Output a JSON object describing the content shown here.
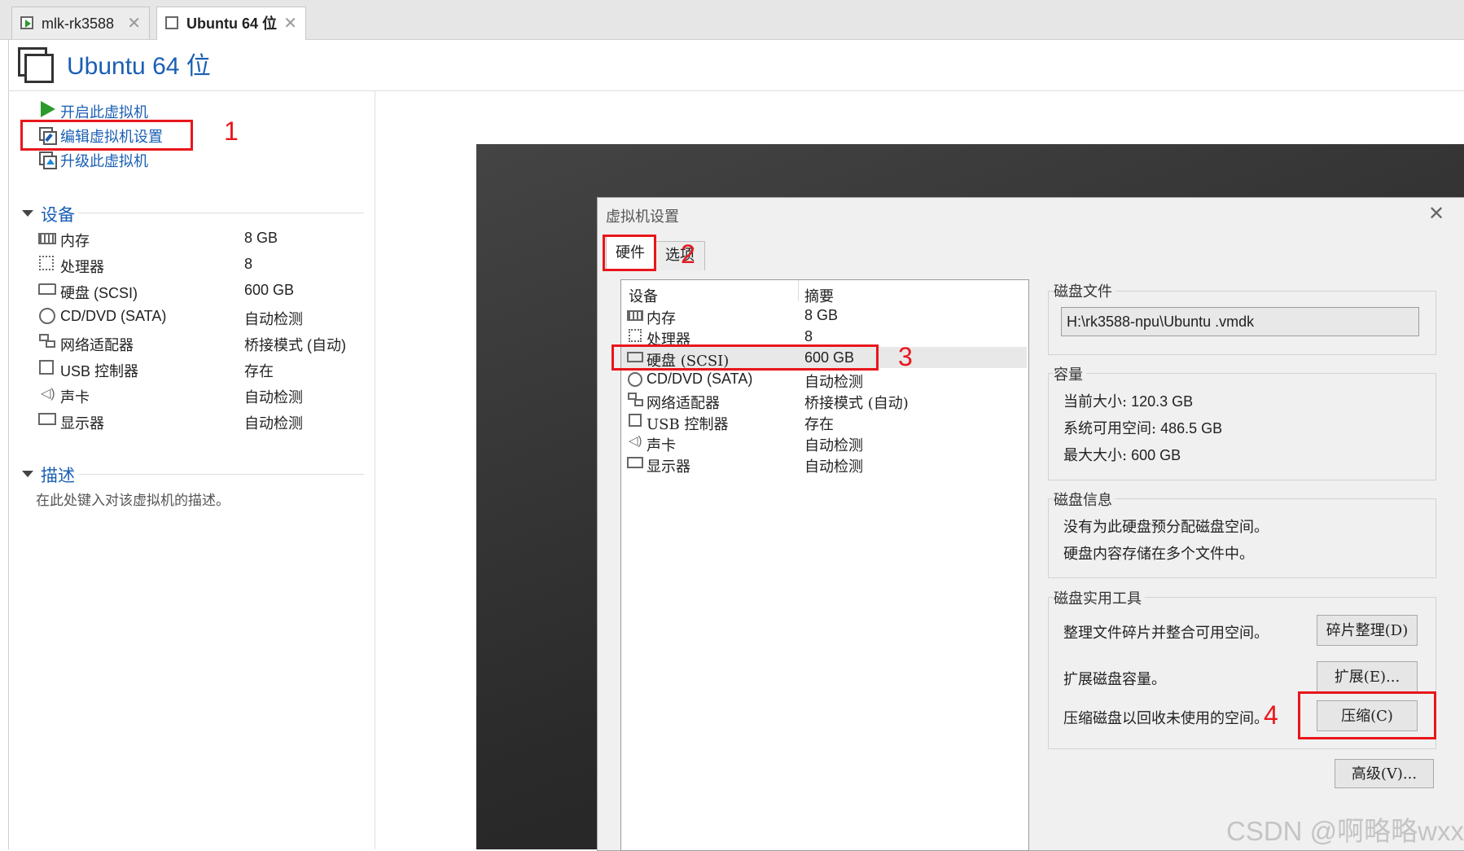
{
  "tabs": [
    {
      "label": "mlk-rk3588"
    },
    {
      "label": "Ubuntu 64 位"
    }
  ],
  "vm": {
    "title": "Ubuntu 64 位"
  },
  "actions": [
    {
      "label": "开启此虚拟机",
      "icon": "play-icon"
    },
    {
      "label": "编辑虚拟机设置",
      "icon": "edit-settings-icon"
    },
    {
      "label": "升级此虚拟机",
      "icon": "upgrade-icon"
    }
  ],
  "devices_section": {
    "title": "设备",
    "items": [
      {
        "name": "内存",
        "value": "8 GB",
        "icon": "memory-icon"
      },
      {
        "name": "处理器",
        "value": "8",
        "icon": "cpu-icon"
      },
      {
        "name": "硬盘 (SCSI)",
        "value": "600 GB",
        "icon": "hard-disk-icon"
      },
      {
        "name": "CD/DVD (SATA)",
        "value": "自动检测",
        "icon": "cd-dvd-icon"
      },
      {
        "name": "网络适配器",
        "value": "桥接模式 (自动)",
        "icon": "network-adapter-icon"
      },
      {
        "name": "USB 控制器",
        "value": "存在",
        "icon": "usb-controller-icon"
      },
      {
        "name": "声卡",
        "value": "自动检测",
        "icon": "sound-card-icon"
      },
      {
        "name": "显示器",
        "value": "自动检测",
        "icon": "display-icon"
      }
    ]
  },
  "description_section": {
    "title": "描述",
    "placeholder": "在此处键入对该虚拟机的描述。"
  },
  "annotations": [
    "1",
    "2",
    "3",
    "4"
  ],
  "dialog": {
    "title": "虚拟机设置",
    "tabs": [
      "硬件",
      "选项"
    ],
    "list_headers": {
      "device": "设备",
      "summary": "摘要"
    },
    "list_items": [
      {
        "name": "内存",
        "summary": "8 GB"
      },
      {
        "name": "处理器",
        "summary": "8"
      },
      {
        "name": "硬盘 (SCSI)",
        "summary": "600 GB",
        "selected": true
      },
      {
        "name": "CD/DVD (SATA)",
        "summary": "自动检测"
      },
      {
        "name": "网络适配器",
        "summary": "桥接模式 (自动)"
      },
      {
        "name": "USB 控制器",
        "summary": "存在"
      },
      {
        "name": "声卡",
        "summary": "自动检测"
      },
      {
        "name": "显示器",
        "summary": "自动检测"
      }
    ],
    "disk_file": {
      "title": "磁盘文件",
      "path": "H:\\rk3588-npu\\Ubuntu .vmdk"
    },
    "capacity": {
      "title": "容量",
      "current_label": "当前大小:",
      "current_value": "120.3 GB",
      "available_label": "系统可用空间:",
      "available_value": "486.5 GB",
      "max_label": "最大大小:",
      "max_value": "600 GB"
    },
    "disk_info": {
      "title": "磁盘信息",
      "line1": "没有为此硬盘预分配磁盘空间。",
      "line2": "硬盘内容存储在多个文件中。"
    },
    "disk_tools": {
      "title": "磁盘实用工具",
      "defrag_text": "整理文件碎片并整合可用空间。",
      "defrag_button": "碎片整理(D)",
      "expand_text": "扩展磁盘容量。",
      "expand_button": "扩展(E)...",
      "compact_text": "压缩磁盘以回收未使用的空间。",
      "compact_button": "压缩(C)"
    },
    "advanced_button": "高级(V)..."
  },
  "watermark": "CSDN @啊略略wxx",
  "colors": {
    "accent": "#1a5fb4",
    "annotation": "#e8161b",
    "play": "#2c9a2c"
  }
}
